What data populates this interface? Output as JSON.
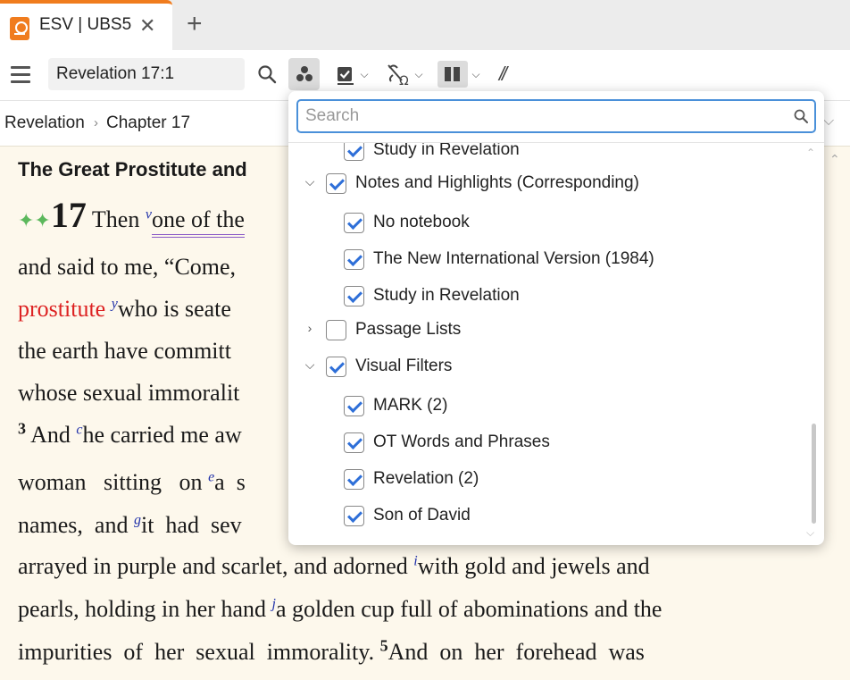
{
  "tab": {
    "title": "ESV | UBS5",
    "close": "✕",
    "add": "+"
  },
  "toolbar": {
    "reference_value": "Revelation 17:1",
    "parallel_label": "//"
  },
  "breadcrumb": {
    "book": "Revelation",
    "separator": "›",
    "chapter": "Chapter 17"
  },
  "passage": {
    "heading": "The Great Prostitute and",
    "chapter_number": "17",
    "lines": [
      {
        "t1": " Then ",
        "fn1": "v",
        "t2": "one of the"
      },
      {
        "t1": "and  said  to  me, “Come,"
      },
      {
        "red": "prostitute",
        "fn1": "y",
        "t2": "who is seate"
      },
      {
        "t1": "the  earth  have  committ"
      },
      {
        "t1": "whose sexual immoralit"
      },
      {
        "vn": "3",
        "t1": " And ",
        "fn1": "c",
        "t2": "he carried me aw"
      },
      {
        "t1": "woman   sitting   on ",
        "fn1": "e",
        "t2": "a  s"
      },
      {
        "t1": "names,  and ",
        "fn1": "g",
        "t2": "it  had  sev"
      },
      {
        "t1": "arrayed in purple and scarlet, and adorned ",
        "fn1": "i",
        "t2": "with gold and jewels and"
      },
      {
        "t1": "pearls, holding in her hand ",
        "fn1": "j",
        "t2": "a golden cup full of abominations and the"
      },
      {
        "t1": "impurities  of  her  sexual  immorality. ",
        "vn": "5",
        "t2": "And  on  her  forehead  was"
      }
    ]
  },
  "filter_panel": {
    "search_placeholder": "Search",
    "items": [
      {
        "label": "Study in Revelation",
        "checked": true,
        "level": 1
      },
      {
        "label": "Notes and Highlights (Corresponding)",
        "checked": true,
        "level": 0,
        "expanded": true
      },
      {
        "label": "No notebook",
        "checked": true,
        "level": 1
      },
      {
        "label": "The New International Version (1984)",
        "checked": true,
        "level": 1
      },
      {
        "label": "Study in Revelation",
        "checked": true,
        "level": 1
      },
      {
        "label": "Passage Lists",
        "checked": false,
        "level": 0,
        "expanded": false
      },
      {
        "label": "Visual Filters",
        "checked": true,
        "level": 0,
        "expanded": true
      },
      {
        "label": "MARK (2)",
        "checked": true,
        "level": 1
      },
      {
        "label": "OT Words and Phrases",
        "checked": true,
        "level": 1
      },
      {
        "label": "Revelation (2)",
        "checked": true,
        "level": 1
      },
      {
        "label": "Son of David",
        "checked": true,
        "level": 1
      }
    ]
  },
  "colors": {
    "accent": "#f07c1e",
    "checkbox": "#2e6fd8",
    "words_of_christ": "#dd2222",
    "footnote": "#2233aa"
  }
}
